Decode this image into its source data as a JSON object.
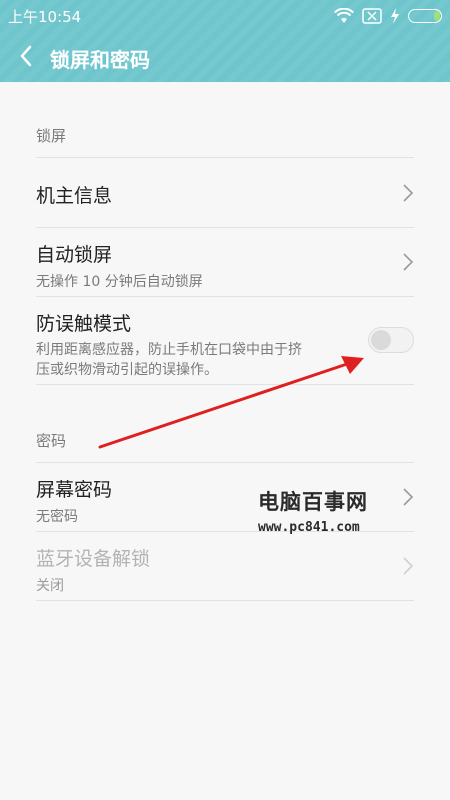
{
  "status_bar": {
    "time": "上午10:54",
    "icons": [
      "wifi-icon",
      "sim-icon",
      "charging-icon",
      "battery-icon"
    ]
  },
  "header": {
    "title": "锁屏和密码",
    "back_icon": "back-arrow-icon"
  },
  "sections": {
    "lock_screen": {
      "header": "锁屏",
      "owner_info": {
        "title": "机主信息"
      },
      "auto_lock": {
        "title": "自动锁屏",
        "subtitle": "无操作 10 分钟后自动锁屏"
      },
      "anti_touch": {
        "title": "防误触模式",
        "subtitle_line1": "利用距离感应器，防止手机在口袋中由于挤",
        "subtitle_line2": "压或织物滑动引起的误操作。",
        "enabled": false
      }
    },
    "password": {
      "header": "密码",
      "screen_password": {
        "title": "屏幕密码",
        "subtitle": "无密码"
      },
      "bluetooth_unlock": {
        "title": "蓝牙设备解锁",
        "subtitle": "关闭"
      }
    }
  },
  "watermark": {
    "main": "电脑百事网",
    "sub": "www.pc841.com"
  },
  "colors": {
    "header_bg": "#6ec5cc",
    "annotation_arrow": "#e02020",
    "page_bg": "#f7f7f7"
  }
}
